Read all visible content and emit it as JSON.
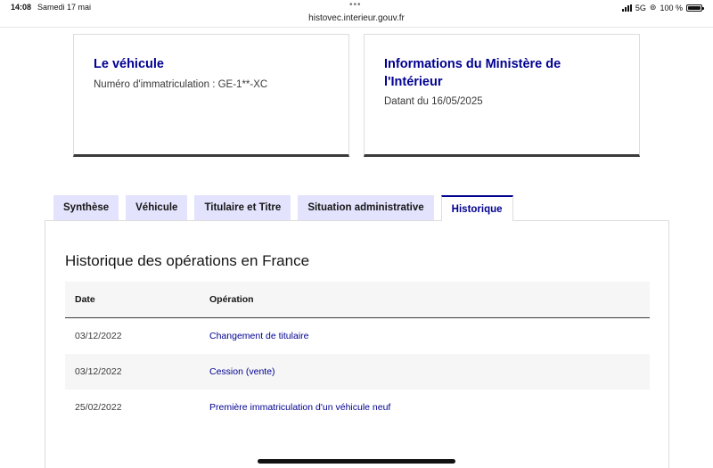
{
  "status": {
    "time": "14:08",
    "date": "Samedi 17 mai",
    "network": "5G",
    "battery": "100 %",
    "battery_level": 1.0
  },
  "url": "histovec.interieur.gouv.fr",
  "cards": {
    "vehicle": {
      "title": "Le véhicule",
      "text": "Numéro d'immatriculation : GE-1**-XC"
    },
    "ministry": {
      "title": "Informations du Ministère de l'Intérieur",
      "text": "Datant du 16/05/2025"
    }
  },
  "tabs": [
    {
      "label": "Synthèse",
      "active": false
    },
    {
      "label": "Véhicule",
      "active": false
    },
    {
      "label": "Titulaire et Titre",
      "active": false
    },
    {
      "label": "Situation administrative",
      "active": false
    },
    {
      "label": "Historique",
      "active": true
    }
  ],
  "history": {
    "title": "Historique des opérations en France",
    "columns": {
      "date": "Date",
      "operation": "Opération"
    },
    "rows": [
      {
        "date": "03/12/2022",
        "operation": "Changement de titulaire"
      },
      {
        "date": "03/12/2022",
        "operation": "Cession (vente)"
      },
      {
        "date": "25/02/2022",
        "operation": "Première immatriculation d'un véhicule neuf"
      }
    ]
  },
  "colors": {
    "brand_blue": "#000091",
    "tab_inactive_bg": "#e3e3fd",
    "row_alt_bg": "#f6f6f6"
  },
  "icons": [
    "signal-icon",
    "wifi-icon",
    "battery-icon",
    "more-dots-icon"
  ]
}
